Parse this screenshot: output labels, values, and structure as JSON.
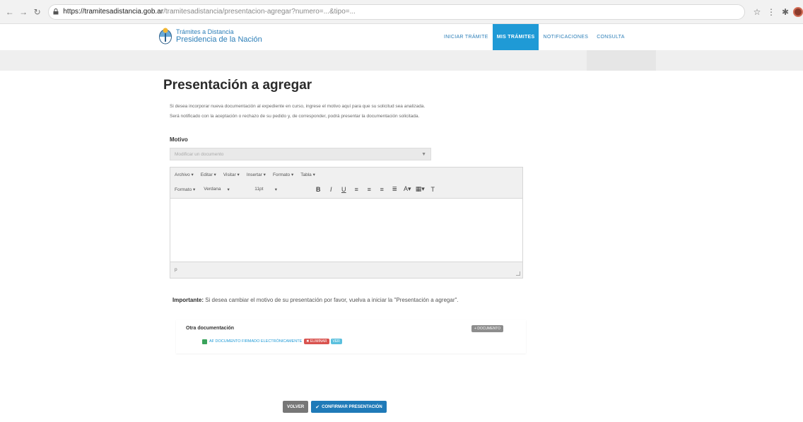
{
  "browser": {
    "url_host": "https://tramitesadistancia.gob.ar",
    "url_path": "/tramitesadistancia/presentacion-agregar?numero=...&tipo=..."
  },
  "header": {
    "logo_top": "Trámites a Distancia",
    "logo_bottom": "Presidencia de la Nación",
    "nav": [
      {
        "label": "INICIAR TRÁMITE",
        "active": false
      },
      {
        "label": "MIS TRÁMITES",
        "active": true
      },
      {
        "label": "NOTIFICACIONES",
        "active": false
      },
      {
        "label": "CONSULTA",
        "active": false
      }
    ]
  },
  "main": {
    "title": "Presentación a agregar",
    "intro": "Si desea incorporar nueva documentación al expediente en curso, ingrese el motivo aquí para que su solicitud sea analizada. Será notificado con la aceptación o rechazo de su pedido y, de corresponder, podrá presentar la documentación solicitada.",
    "motivo_label": "Motivo",
    "motivo_placeholder": "Modificar un documento",
    "editor": {
      "menus": [
        "Archivo ▾",
        "Editar ▾",
        "Visitar ▾",
        "Insertar ▾",
        "Formato ▾",
        "Tabla ▾"
      ],
      "format_label": "Formato ▾",
      "font_label": "Verdana",
      "size_label": "11pt",
      "status_path": "p"
    },
    "important_label": "Importante:",
    "important_text": " Si desea cambiar el motivo de su presentación por favor, vuelva a iniciar la \"Presentación a agregar\".",
    "docs": {
      "title": "Otra documentación",
      "add_label": "+ DOCUMENTO",
      "item_label": "AF DOCUMENTO FIRMADO ELECTRÓNICAMENTE",
      "badge_delete": "✖ ELIMINAR",
      "badge_view": "VER"
    },
    "back_label": "VOLVER",
    "confirm_label": "CONFIRMAR PRESENTACIÓN"
  },
  "colors": {
    "accent": "#1f9ad6",
    "confirm": "#1f7ab8",
    "delete": "#d9534f"
  }
}
